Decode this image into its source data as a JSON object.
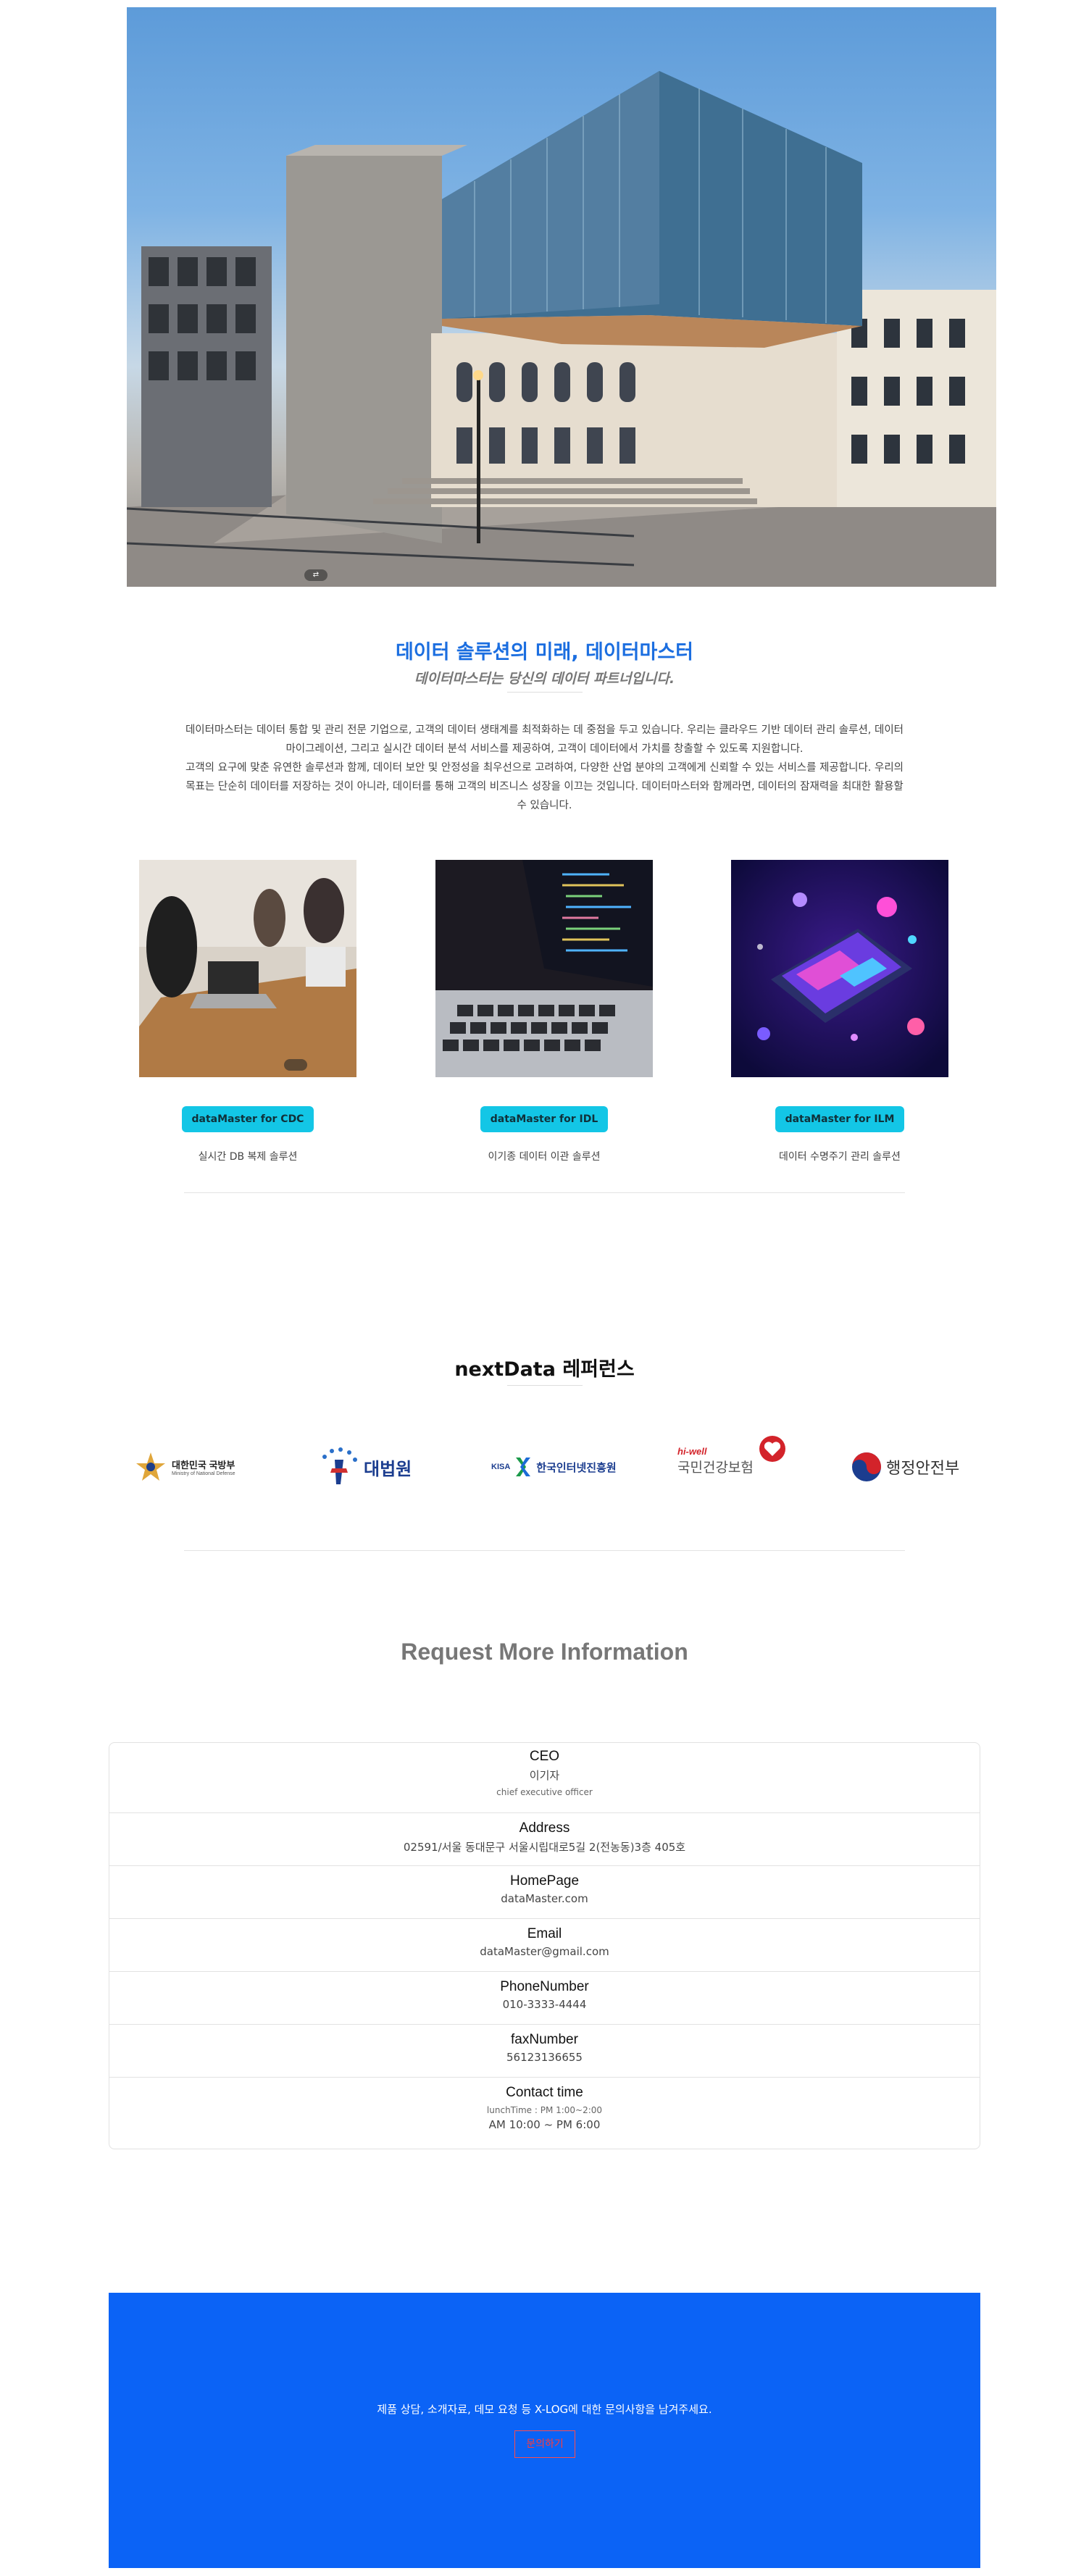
{
  "hero": {
    "slider_indicator": "⇄"
  },
  "intro": {
    "title": "데이터 솔루션의 미래, 데이터마스터",
    "subtitle": "데이터마스터는 당신의 데이터 파트너입니다.",
    "body_lines": [
      "데이터마스터는 데이터 통합 및 관리 전문 기업으로, 고객의 데이터 생태계를 최적화하는 데 중점을 두고 있습니다. 우리는 클라우드 기반 데이터 관리 솔루션, 데이터",
      "마이그레이션, 그리고 실시간 데이터 분석 서비스를 제공하여, 고객이 데이터에서 가치를 창출할 수 있도록 지원합니다.",
      "고객의 요구에 맞춘 유연한 솔루션과 함께, 데이터 보안 및 안정성을 최우선으로 고려하여, 다양한 산업 분야의 고객에게 신뢰할 수 있는 서비스를 제공합니다. 우리의",
      "목표는 단순히 데이터를 저장하는 것이 아니라, 데이터를 통해 고객의 비즈니스 성장을 이끄는 것입니다. 데이터마스터와 함께라면, 데이터의 잠재력을 최대한 활용할",
      "수 있습니다."
    ]
  },
  "products": [
    {
      "button": "dataMaster for CDC",
      "desc": "실시간 DB 복제 솔루션"
    },
    {
      "button": "dataMaster for IDL",
      "desc": "이기종 데이터 이관 솔루션"
    },
    {
      "button": "dataMaster for ILM",
      "desc": "데이터 수명주기 관리 솔루션"
    }
  ],
  "references": {
    "title": "nextData 레퍼런스",
    "logos": [
      {
        "name": "대한민국 국방부",
        "sub": "Ministry of National Defense"
      },
      {
        "name": "대법원"
      },
      {
        "name": "한국인터넷진흥원",
        "prefix": "KISA"
      },
      {
        "name": "국민건강보험",
        "prefix": "hi-well"
      },
      {
        "name": "행정안전부"
      }
    ]
  },
  "request": {
    "title": "Request More Information",
    "ceo": {
      "label": "CEO",
      "value": "이기자",
      "sub": "chief executive officer"
    },
    "address": {
      "label": "Address",
      "value": "02591/서울 동대문구 서울시립대로5길 2(전농동)3층 405호"
    },
    "homepage": {
      "label": "HomePage",
      "value": "dataMaster.com"
    },
    "email": {
      "label": "Email",
      "value": "dataMaster@gmail.com"
    },
    "phone": {
      "label": "PhoneNumber",
      "value": "010-3333-4444"
    },
    "fax": {
      "label": "faxNumber",
      "value": "56123136655"
    },
    "contact_time": {
      "label": "Contact time",
      "lunch": "lunchTime : PM 1:00~2:00",
      "hours": "AM 10:00 ~ PM 6:00"
    }
  },
  "banner": {
    "message": "제품 상담, 소개자료, 데모 요청 등 X-LOG에 대한 문의사항을 남겨주세요.",
    "cta": "문의하기"
  },
  "colors": {
    "accent": "#1b6ee0",
    "button": "#13c6e6",
    "banner": "#0b63f6",
    "cta": "#ff3b3b"
  }
}
